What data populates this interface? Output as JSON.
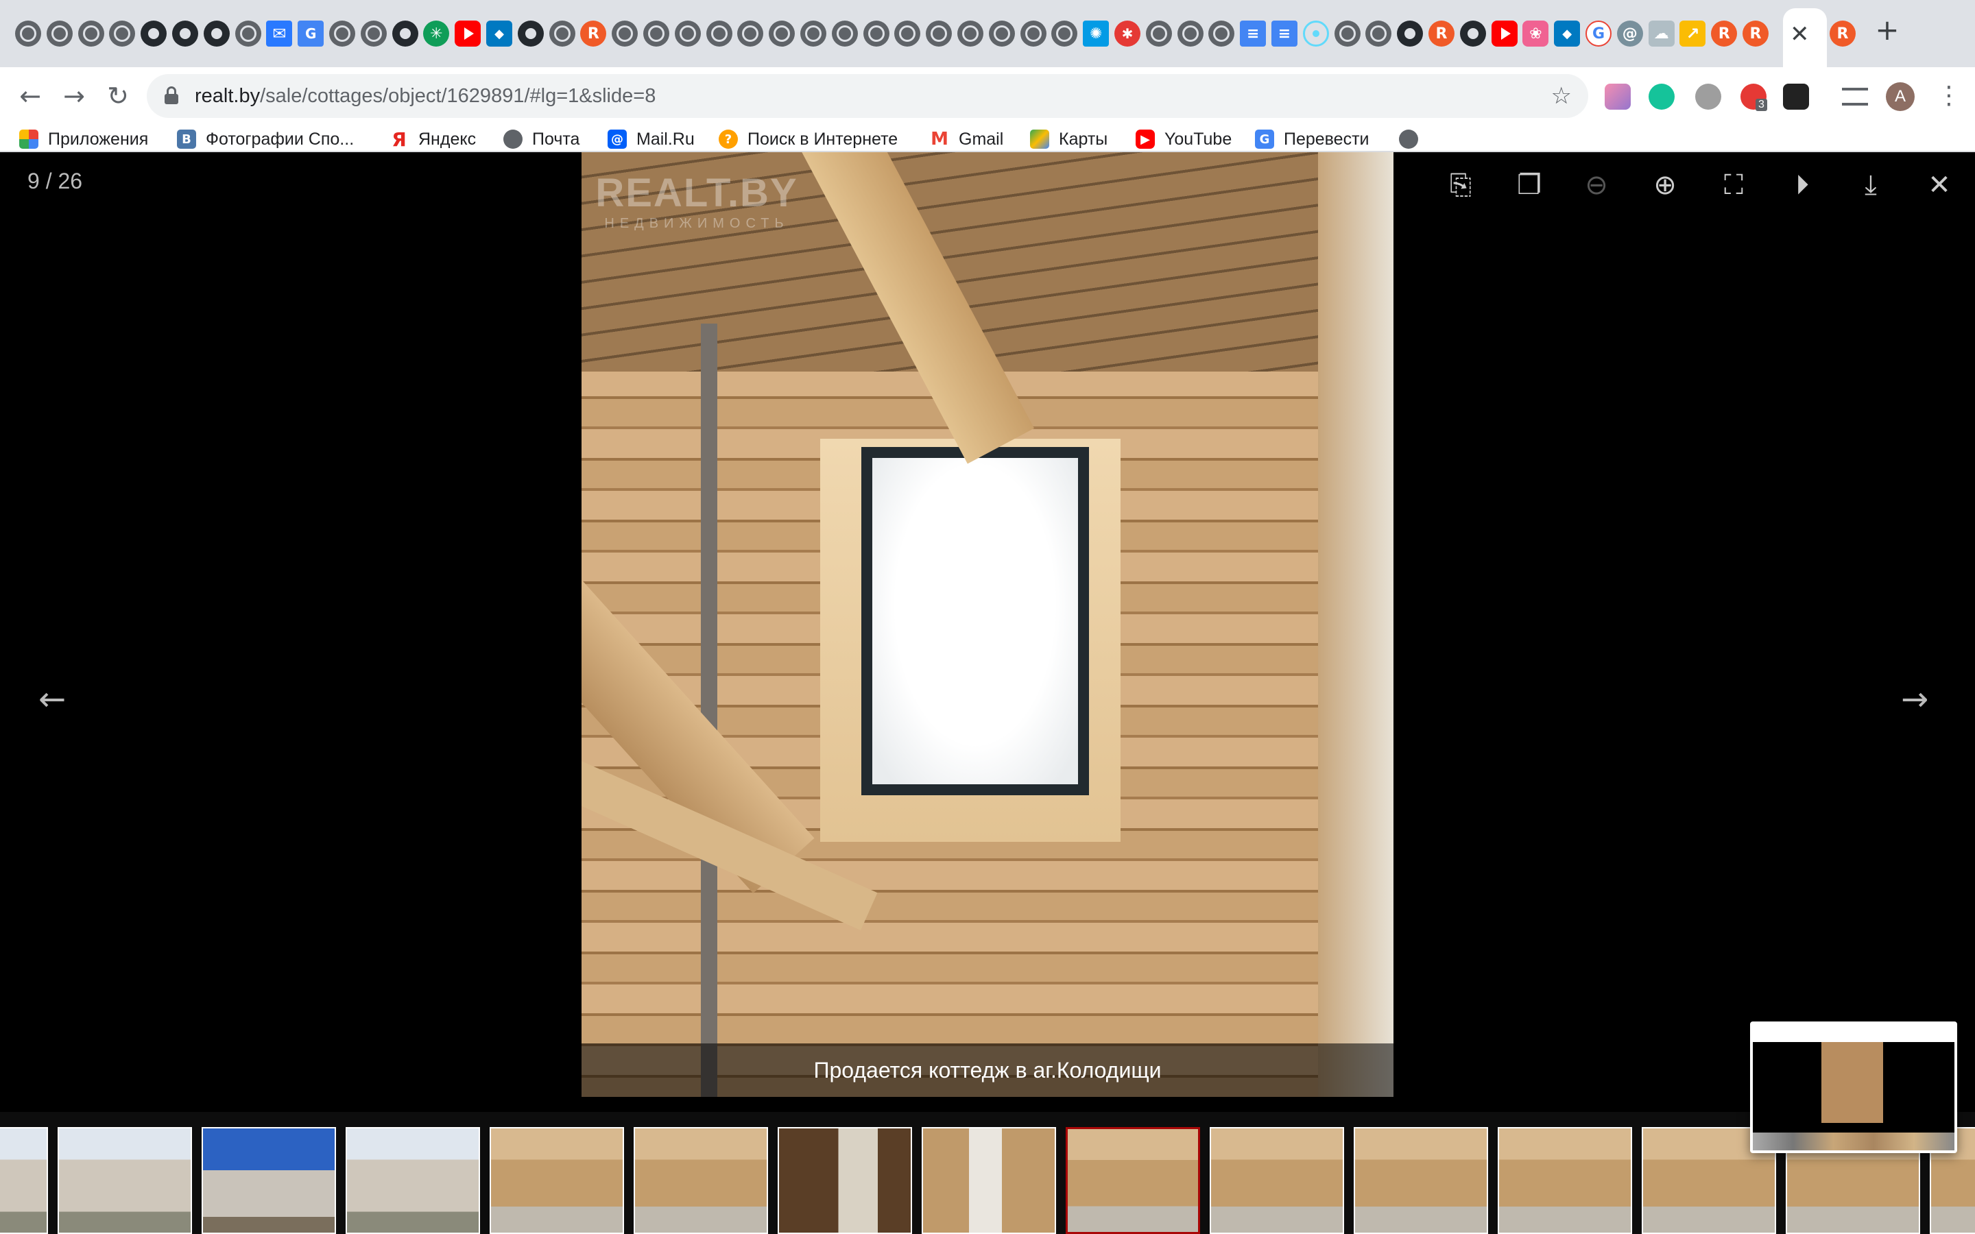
{
  "tabs": {
    "icons": [
      "globe",
      "globe",
      "globe",
      "globe",
      "github",
      "github",
      "github",
      "globe",
      "mail",
      "translate",
      "globe",
      "globe",
      "github",
      "green-snowflake",
      "youtube",
      "fish",
      "github",
      "globe",
      "r-logo",
      "globe",
      "globe",
      "globe",
      "globe",
      "globe",
      "globe",
      "globe",
      "globe",
      "globe",
      "globe",
      "globe",
      "globe",
      "globe",
      "globe",
      "globe",
      "blue-star",
      "red-figure",
      "globe",
      "globe",
      "globe",
      "google-docs",
      "google-docs",
      "react",
      "globe",
      "globe",
      "github",
      "r-logo",
      "github",
      "youtube",
      "pink-flower",
      "fish",
      "google",
      "swirl",
      "cloud",
      "arrow",
      "r-logo",
      "r-logo"
    ],
    "active_close": "✕",
    "new_tab": "+"
  },
  "toolbar": {
    "back": "←",
    "forward": "→",
    "reload": "↻",
    "url_host": "realt.by",
    "url_path": "/sale/cottages/object/1629891/#lg=1&slide=8",
    "star": "☆",
    "avatar_letter": "A",
    "extensions_badge": "3",
    "menu": "⋮"
  },
  "bookmarks": [
    {
      "label": "Приложения",
      "icon": "apps-grid"
    },
    {
      "label": "Фотографии Спо...",
      "icon": "vk"
    },
    {
      "label": "Яндекс",
      "icon": "yandex"
    },
    {
      "label": "Почта",
      "icon": "globe"
    },
    {
      "label": "Mail.Ru",
      "icon": "mailru"
    },
    {
      "label": "Поиск в Интернете",
      "icon": "search-globe"
    },
    {
      "label": "Gmail",
      "icon": "gmail"
    },
    {
      "label": "Карты",
      "icon": "google-maps"
    },
    {
      "label": "YouTube",
      "icon": "youtube"
    },
    {
      "label": "Перевести",
      "icon": "google-translate"
    },
    {
      "label": "",
      "icon": "globe"
    }
  ],
  "viewer": {
    "counter": "9 / 26",
    "caption": "Продается коттедж в аг.Колодищи",
    "watermark": "REALT.BY",
    "watermark_sub": "НЕДВИЖИМОСТЬ",
    "prev": "←",
    "next": "→",
    "buttons": {
      "share": "share-icon",
      "thumbnails": "copy-icon",
      "zoom_out": "zoom-out-icon",
      "zoom_in": "zoom-in-icon",
      "fullscreen": "fullscreen-icon",
      "autoplay": "play-icon",
      "download": "download-icon",
      "close": "close-icon"
    },
    "thumbnails": [
      "exterior",
      "exterior",
      "exterior-sky",
      "exterior",
      "interior",
      "interior",
      "interior-dark",
      "interior-window",
      "interior",
      "interior",
      "interior",
      "interior",
      "interior",
      "interior",
      "interior"
    ],
    "active_thumbnail": 8
  }
}
